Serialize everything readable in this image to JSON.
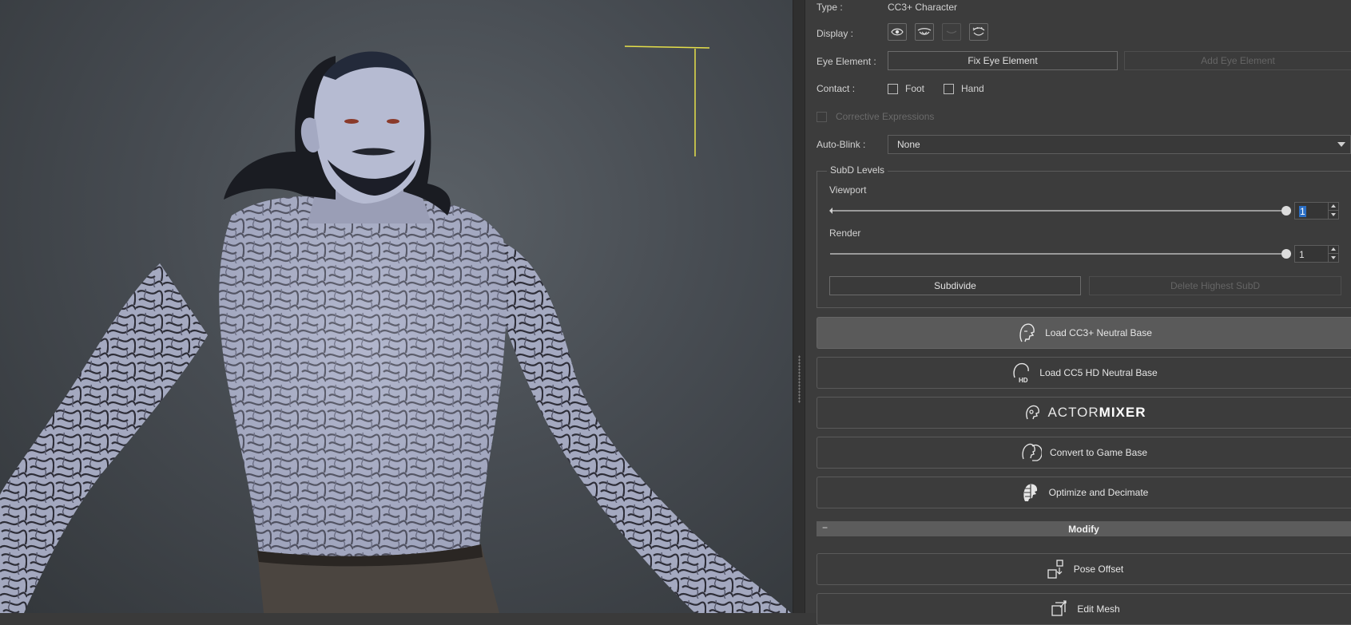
{
  "viewport": {
    "gizmo_color": "#e6e04a",
    "background_color": "#4a4f55"
  },
  "panel": {
    "type_label": "Type :",
    "type_value": "CC3+ Character",
    "display_label": "Display :",
    "display_icons": [
      "eye-open-icon",
      "eye-lashes-icon",
      "eye-closed-icon",
      "eye-blink-icon"
    ],
    "eye_element_label": "Eye Element :",
    "fix_eye_element": "Fix Eye Element",
    "add_eye_element": "Add Eye Element",
    "contact_label": "Contact :",
    "foot_label": "Foot",
    "hand_label": "Hand",
    "corrective_expressions": "Corrective Expressions",
    "auto_blink_label": "Auto-Blink :",
    "auto_blink_value": "None",
    "subd": {
      "title": "SubD Levels",
      "viewport_label": "Viewport",
      "viewport_value": "1",
      "render_label": "Render",
      "render_value": "1",
      "subdivide": "Subdivide",
      "delete_highest": "Delete Highest SubD"
    },
    "buttons": {
      "load_cc3": "Load CC3+ Neutral Base",
      "load_cc5": "Load CC5 HD Neutral Base",
      "actor_mixer_a": "ACTOR",
      "actor_mixer_b": "MIXER",
      "convert_game": "Convert to Game Base",
      "optimize": "Optimize and Decimate",
      "pose_offset": "Pose Offset",
      "edit_mesh": "Edit Mesh"
    },
    "modify_section": "Modify",
    "modify_minus": "−"
  }
}
